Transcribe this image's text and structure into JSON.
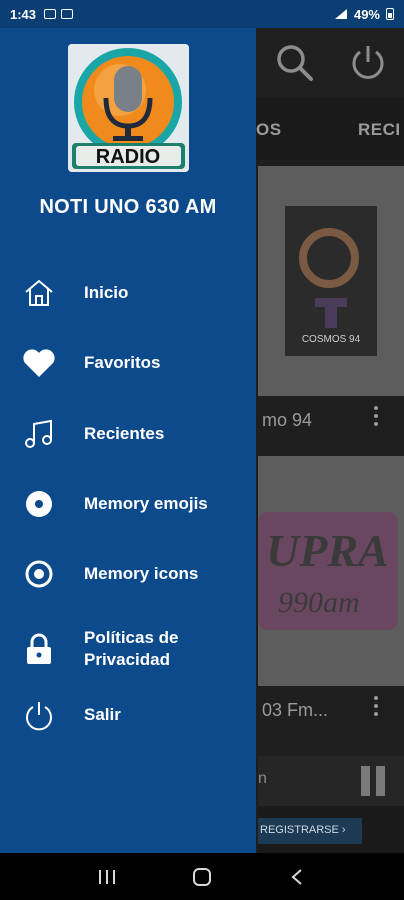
{
  "status_bar": {
    "time": "1:43",
    "battery": "49%"
  },
  "drawer": {
    "station_title": "NOTI UNO 630 AM",
    "logo_text": "RADIO",
    "items": [
      {
        "label": "Inicio",
        "icon": "home-icon"
      },
      {
        "label": "Favoritos",
        "icon": "heart-icon"
      },
      {
        "label": "Recientes",
        "icon": "music-note-icon"
      },
      {
        "label": "Memory emojis",
        "icon": "disc-icon"
      },
      {
        "label": "Memory icons",
        "icon": "radio-button-icon"
      },
      {
        "label": "Políticas de\nPrivacidad",
        "icon": "lock-icon"
      },
      {
        "label": "Salir",
        "icon": "power-icon"
      }
    ]
  },
  "background": {
    "tab_1": "OS",
    "tab_2": "RECI",
    "card_1_name": "mo 94",
    "card_2_name": "03 Fm...",
    "card_1_logo_text": "COSMOS 94",
    "card_2_logo_text_a": "UPRA",
    "card_2_logo_text_b": "990am",
    "player_text": "n",
    "ad_button": "REGISTRARSE ›"
  },
  "colors": {
    "drawer_bg": "#0d4a8c",
    "text": "#ffffff"
  }
}
